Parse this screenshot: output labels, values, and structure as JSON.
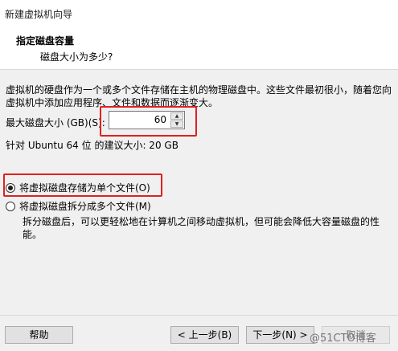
{
  "window": {
    "title": "新建虚拟机向导"
  },
  "header": {
    "title": "指定磁盘容量",
    "subtitle": "磁盘大小为多少?"
  },
  "description": "虚拟机的硬盘作为一个或多个文件存储在主机的物理磁盘中。这些文件最初很小，随着您向虚拟机中添加应用程序、文件和数据而逐渐变大。",
  "disk_size": {
    "label": "最大磁盘大小 (GB)(S):",
    "value": "60",
    "up_arrow": "▲",
    "down_arrow": "▼"
  },
  "recommendation": "针对 Ubuntu 64 位 的建议大小: 20 GB",
  "options": {
    "single": {
      "label": "将虚拟磁盘存储为单个文件(O)",
      "selected": true
    },
    "multiple": {
      "label": "将虚拟磁盘拆分成多个文件(M)",
      "selected": false
    },
    "multiple_hint": "拆分磁盘后，可以更轻松地在计算机之间移动虚拟机，但可能会降低大容量磁盘的性能。"
  },
  "buttons": {
    "help": "帮助",
    "back": "< 上一步(B)",
    "next": "下一步(N) >",
    "cancel": "取消"
  },
  "watermark": "@51CTO博客",
  "colors": {
    "highlight_box": "#e02020"
  }
}
